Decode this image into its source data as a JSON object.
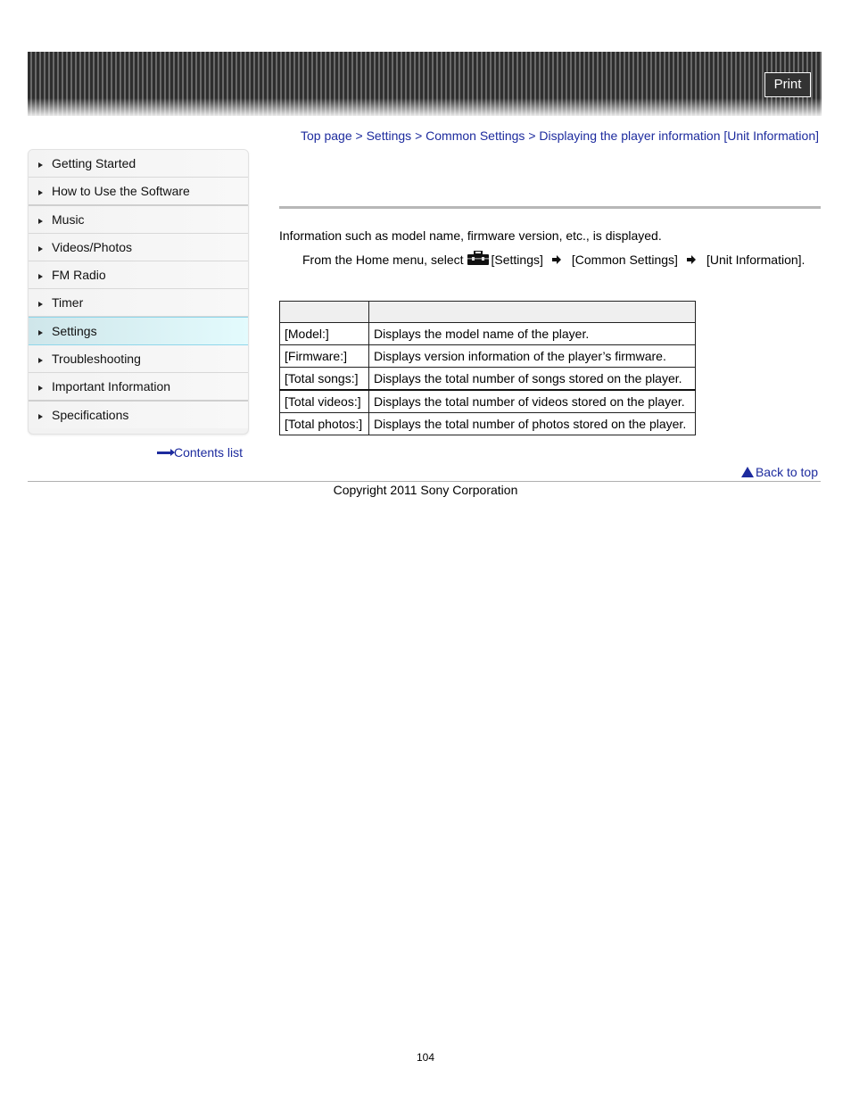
{
  "header": {
    "print_label": "Print"
  },
  "breadcrumb": {
    "items": [
      "Top page",
      "Settings",
      "Common Settings",
      "Displaying the player information [Unit Information]"
    ],
    "separator": ">"
  },
  "sidebar": {
    "items": [
      {
        "label": "Getting Started",
        "active": false
      },
      {
        "label": "How to Use the Software",
        "active": false
      },
      {
        "label": "Music",
        "active": false
      },
      {
        "label": "Videos/Photos",
        "active": false
      },
      {
        "label": "FM Radio",
        "active": false
      },
      {
        "label": "Timer",
        "active": false
      },
      {
        "label": "Settings",
        "active": true
      },
      {
        "label": "Troubleshooting",
        "active": false
      },
      {
        "label": "Important Information",
        "active": false
      },
      {
        "label": "Specifications",
        "active": false
      }
    ],
    "contents_list_label": "Contents list"
  },
  "main": {
    "intro": "Information such as model name, firmware version, etc., is displayed.",
    "step": {
      "prefix": "From the Home menu, select",
      "icon": "settings-toolbox-icon",
      "items": [
        "[Settings]",
        "[Common Settings]",
        "[Unit Information]."
      ]
    },
    "table": {
      "headers": [
        "",
        ""
      ],
      "rows": [
        [
          "[Model:]",
          "Displays the model name of the player."
        ],
        [
          "[Firmware:]",
          "Displays version information of the player’s firmware."
        ],
        [
          "[Total songs:]",
          "Displays the total number of songs stored on the player."
        ],
        [
          "[Total videos:]",
          "Displays the total number of videos stored on the player."
        ],
        [
          "[Total photos:]",
          "Displays the total number of photos stored on the player."
        ]
      ]
    }
  },
  "footer": {
    "back_to_top_label": "Back to top",
    "copyright": "Copyright 2011 Sony Corporation",
    "page_number": "104"
  }
}
